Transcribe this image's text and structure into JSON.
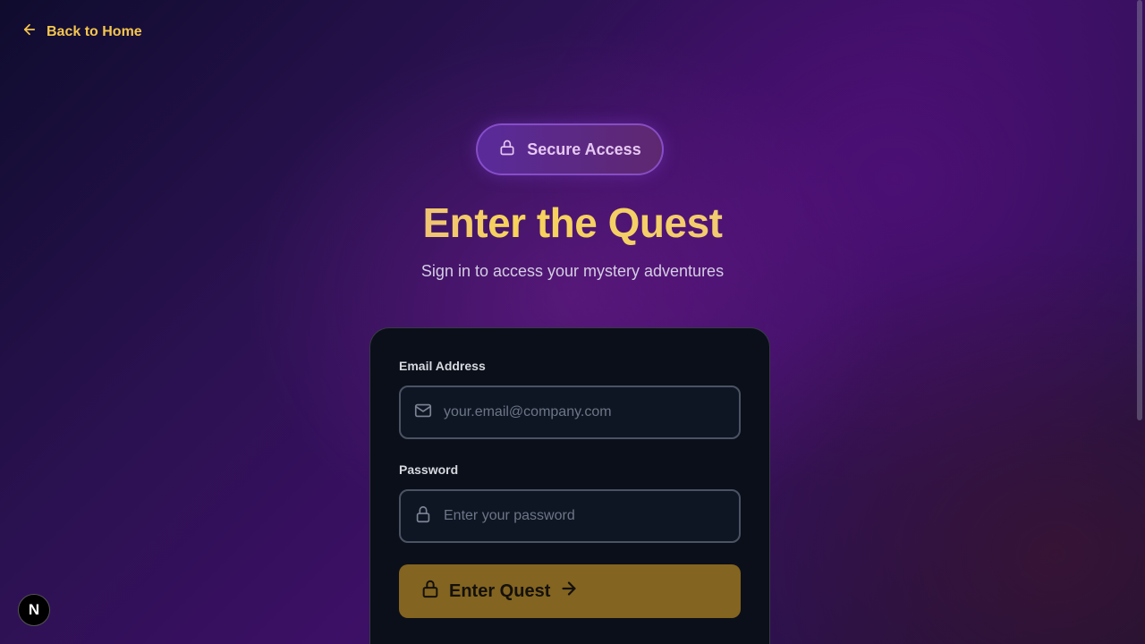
{
  "nav": {
    "back_label": "Back to Home"
  },
  "badge": {
    "label": "Secure Access"
  },
  "hero": {
    "title": "Enter the Quest",
    "subtitle": "Sign in to access your mystery adventures"
  },
  "form": {
    "email": {
      "label": "Email Address",
      "placeholder": "your.email@company.com",
      "value": ""
    },
    "password": {
      "label": "Password",
      "placeholder": "Enter your password",
      "value": ""
    },
    "submit_label": "Enter Quest"
  },
  "dev_indicator": {
    "label": "N"
  },
  "colors": {
    "accent": "#f5c64e",
    "button": "#836420",
    "card": "#0b0f1a",
    "badge_border": "#965adc"
  },
  "icons": [
    "arrow-left-icon",
    "lock-icon",
    "mail-icon",
    "arrow-right-icon"
  ]
}
